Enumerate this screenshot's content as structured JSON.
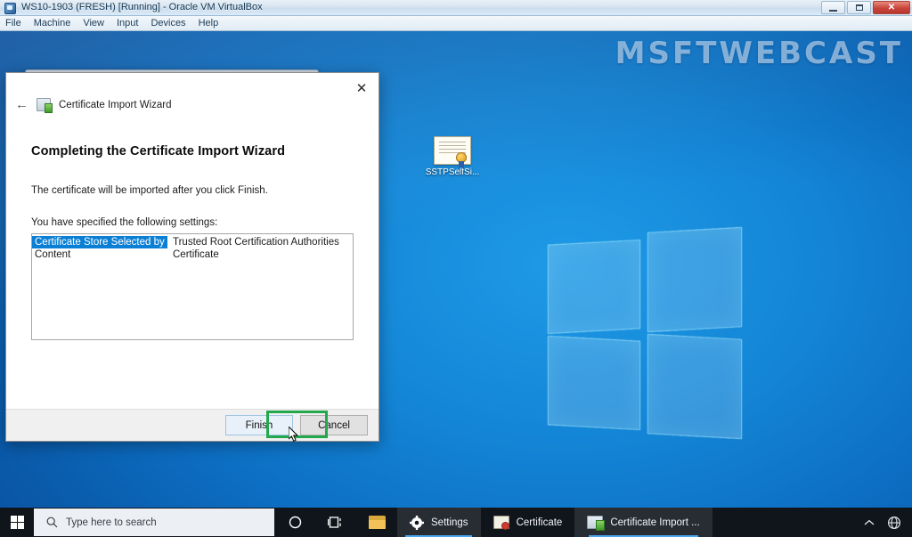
{
  "host_window": {
    "title": "WS10-1903 (FRESH) [Running] - Oracle VM VirtualBox",
    "app_icon": "virtualbox-icon",
    "minimize_label": "Minimize",
    "maximize_label": "Maximize",
    "close_label": "Close",
    "menu": [
      {
        "label": "File"
      },
      {
        "label": "Machine"
      },
      {
        "label": "View"
      },
      {
        "label": "Input"
      },
      {
        "label": "Devices"
      },
      {
        "label": "Help"
      }
    ]
  },
  "desktop": {
    "watermark": "MSFTWEBCAST",
    "icons": [
      {
        "label": "SSTPSelfSi...",
        "icon": "certificate-icon"
      }
    ]
  },
  "dialog": {
    "nav_title": "Certificate Import Wizard",
    "nav_icon": "certificate-wizard-icon",
    "back_arrow": "←",
    "close_glyph": "✕",
    "heading": "Completing the Certificate Import Wizard",
    "paragraph": "The certificate will be imported after you click Finish.",
    "settings_label": "You have specified the following settings:",
    "settings": [
      {
        "key": "Certificate Store Selected by User",
        "value": "Trusted Root Certification Authorities",
        "selected": true
      },
      {
        "key": "Content",
        "value": "Certificate",
        "selected": false
      }
    ],
    "buttons": {
      "finish": "Finish",
      "cancel": "Cancel"
    },
    "highlight_color": "#23a94c"
  },
  "taskbar": {
    "start_label": "Start",
    "search_placeholder": "Type here to search",
    "search_icon": "search-icon",
    "cortana_icon": "cortana-circle-icon",
    "task_view_icon": "task-view-icon",
    "pinned": [
      {
        "label": "File Explorer",
        "icon": "folder-icon"
      },
      {
        "label": "Settings",
        "icon": "gear-icon",
        "active": true
      }
    ],
    "windows": [
      {
        "label": "Certificate",
        "icon": "certificate-icon",
        "active": false
      },
      {
        "label": "Certificate Import ...",
        "icon": "certificate-wizard-icon",
        "active": true
      }
    ],
    "tray": [
      {
        "label": "Show hidden icons",
        "icon": "chevron-up-icon"
      },
      {
        "label": "Network",
        "icon": "network-globe-icon"
      }
    ]
  }
}
